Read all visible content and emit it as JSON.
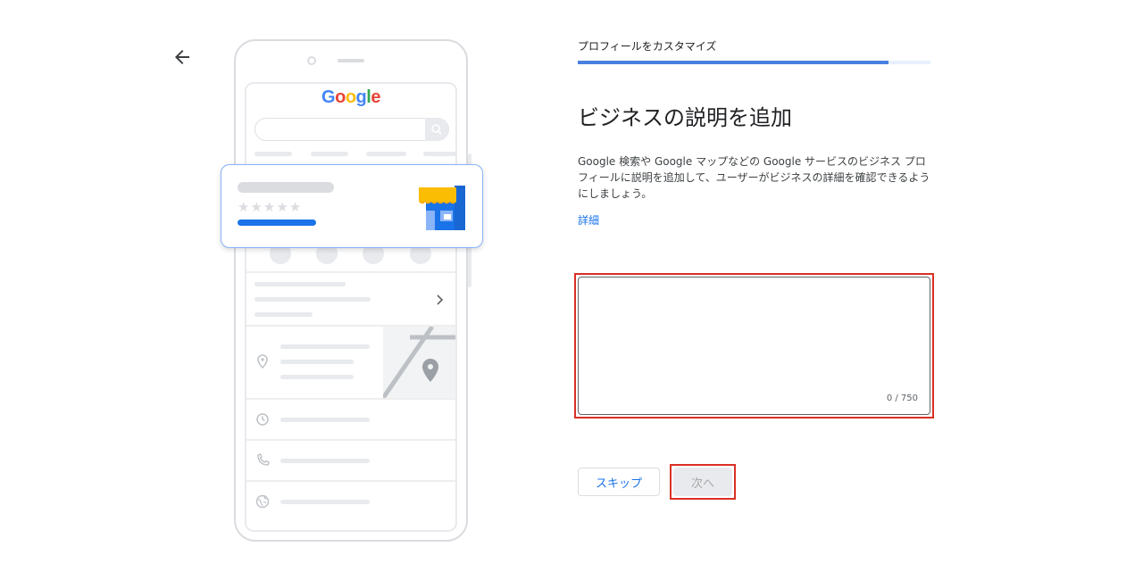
{
  "header": {
    "step_label": "プロフィールをカスタマイズ",
    "progress": 0.88
  },
  "main": {
    "title": "ビジネスの説明を追加",
    "description": "Google 検索や Google マップなどの Google サービスのビジネス プロフィールに説明を追加して、ユーザーがビジネスの詳細を確認できるようにしましょう。",
    "learn_more": "詳細"
  },
  "textarea": {
    "value": "",
    "counter": "0 / 750",
    "max_length": 750
  },
  "buttons": {
    "skip": "スキップ",
    "next": "次へ"
  },
  "illustration": {
    "logo_text": "Google"
  },
  "colors": {
    "accent": "#1a73e8",
    "progress": "#4a7fe0",
    "highlight": "#d93025"
  },
  "icons": [
    "back-arrow-icon",
    "search-icon",
    "star-icon",
    "store-icon",
    "phone-icon",
    "directions-icon",
    "save-icon",
    "website-icon",
    "chevron-right-icon",
    "location-pin-icon",
    "clock-icon",
    "globe-icon",
    "map-pin-icon"
  ]
}
